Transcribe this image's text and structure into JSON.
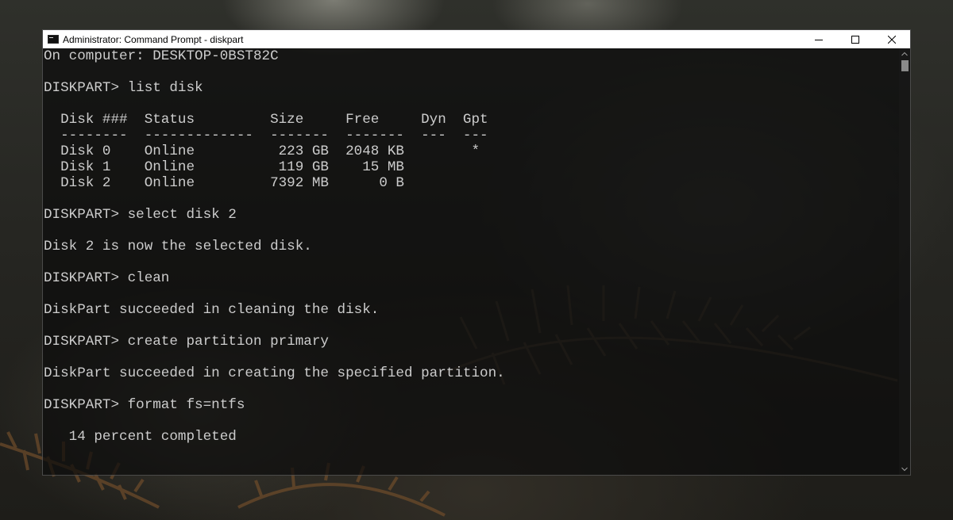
{
  "window": {
    "title": "Administrator: Command Prompt - diskpart",
    "app_icon": "cmd-icon",
    "controls": [
      "minimize-icon",
      "maximize-icon",
      "close-icon"
    ]
  },
  "terminal": {
    "lines": [
      "On computer: DESKTOP-0BST82C",
      "",
      "DISKPART> list disk",
      "",
      "  Disk ###  Status         Size     Free     Dyn  Gpt",
      "  --------  -------------  -------  -------  ---  ---",
      "  Disk 0    Online          223 GB  2048 KB        *",
      "  Disk 1    Online          119 GB    15 MB",
      "  Disk 2    Online         7392 MB      0 B",
      "",
      "DISKPART> select disk 2",
      "",
      "Disk 2 is now the selected disk.",
      "",
      "DISKPART> clean",
      "",
      "DiskPart succeeded in cleaning the disk.",
      "",
      "DISKPART> create partition primary",
      "",
      "DiskPart succeeded in creating the specified partition.",
      "",
      "DISKPART> format fs=ntfs",
      "",
      "   14 percent completed"
    ]
  },
  "colors": {
    "terminal_text": "#cccccc",
    "titlebar_bg": "#ffffff"
  }
}
